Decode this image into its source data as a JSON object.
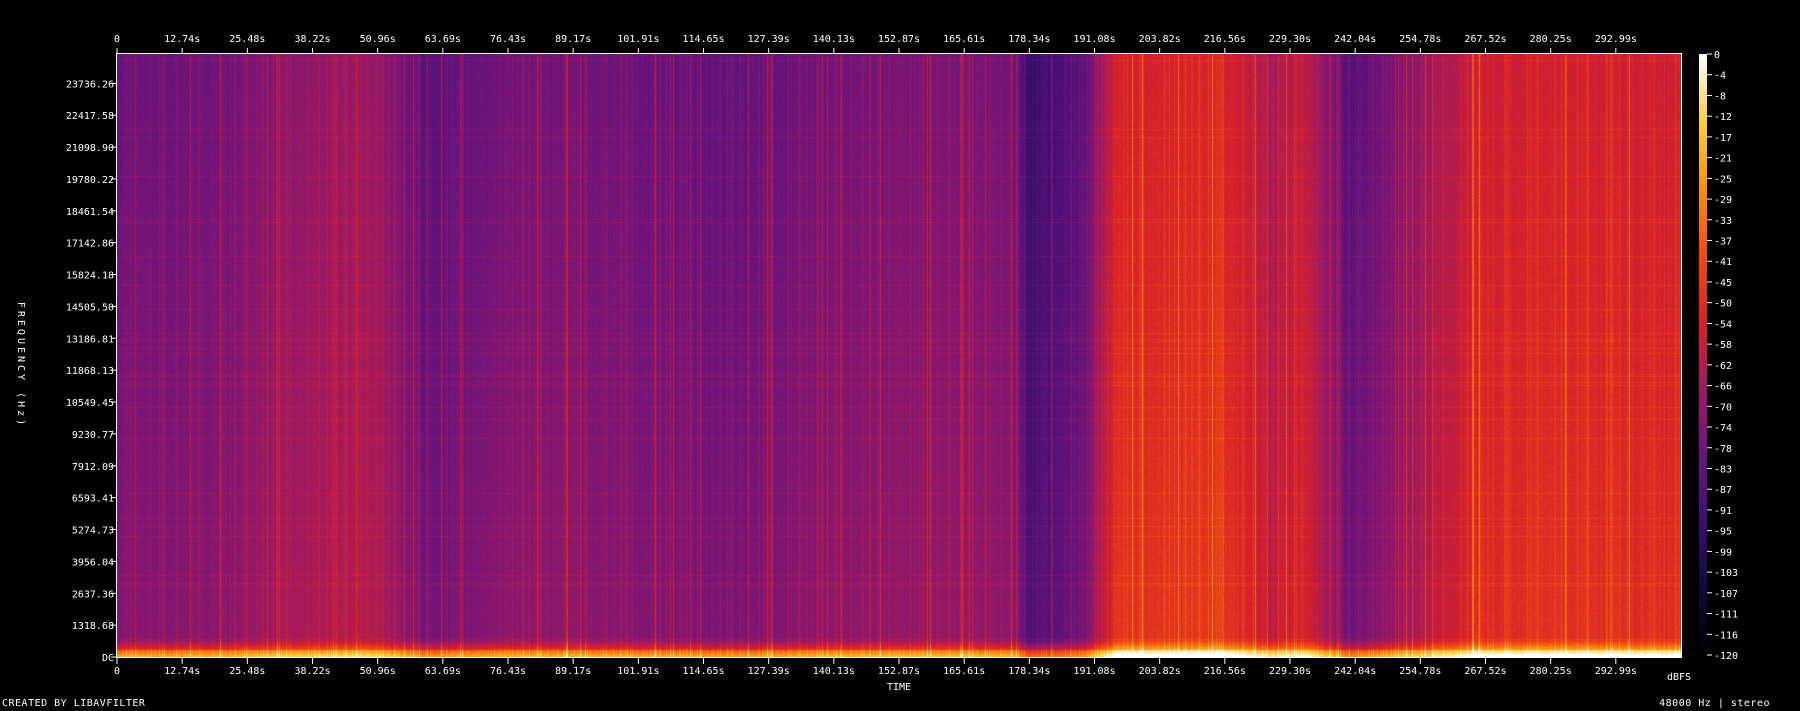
{
  "chart_data": {
    "type": "heatmap",
    "title": "",
    "xlabel": "TIME",
    "ylabel": "FREQUENCY (Hz)",
    "colorbar_label": "dBFS",
    "x_ticks": [
      "0",
      "12.74s",
      "25.48s",
      "38.22s",
      "50.96s",
      "63.69s",
      "76.43s",
      "89.17s",
      "101.91s",
      "114.65s",
      "127.39s",
      "140.13s",
      "152.87s",
      "165.61s",
      "178.34s",
      "191.08s",
      "203.82s",
      "216.56s",
      "229.30s",
      "242.04s",
      "254.78s",
      "267.52s",
      "280.25s",
      "292.99s"
    ],
    "y_ticks": [
      "DC",
      "1318.68",
      "2637.36",
      "3956.04",
      "5274.73",
      "6593.41",
      "7912.09",
      "9230.77",
      "10549.45",
      "11868.13",
      "13186.81",
      "14505.50",
      "15824.18",
      "17142.86",
      "18461.54",
      "19780.22",
      "21098.90",
      "22417.58",
      "23736.26"
    ],
    "colorbar_ticks": [
      "0",
      "-4",
      "-8",
      "-12",
      "-17",
      "-21",
      "-25",
      "-29",
      "-33",
      "-37",
      "-41",
      "-45",
      "-50",
      "-54",
      "-58",
      "-62",
      "-66",
      "-70",
      "-74",
      "-78",
      "-83",
      "-87",
      "-91",
      "-95",
      "-99",
      "-103",
      "-107",
      "-111",
      "-116",
      "-120"
    ],
    "xlim": [
      0,
      305
    ],
    "ylim": [
      0,
      24000
    ],
    "zlim": [
      -120,
      0
    ],
    "colormap": [
      "#000000",
      "#0d0a3a",
      "#3a0f70",
      "#6a147e",
      "#a01a60",
      "#d8202a",
      "#f04a14",
      "#f89012",
      "#fcd040",
      "#ffffff"
    ],
    "time_profile": [
      {
        "t": 0,
        "level": 0.4
      },
      {
        "t": 20,
        "level": 0.42
      },
      {
        "t": 38,
        "level": 0.48
      },
      {
        "t": 50,
        "level": 0.5
      },
      {
        "t": 60,
        "level": 0.36
      },
      {
        "t": 75,
        "level": 0.42
      },
      {
        "t": 90,
        "level": 0.42
      },
      {
        "t": 120,
        "level": 0.38
      },
      {
        "t": 140,
        "level": 0.42
      },
      {
        "t": 165,
        "level": 0.44
      },
      {
        "t": 175,
        "level": 0.42
      },
      {
        "t": 178,
        "level": 0.28
      },
      {
        "t": 188,
        "level": 0.36
      },
      {
        "t": 195,
        "level": 0.62
      },
      {
        "t": 215,
        "level": 0.64
      },
      {
        "t": 225,
        "level": 0.52
      },
      {
        "t": 232,
        "level": 0.58
      },
      {
        "t": 240,
        "level": 0.34
      },
      {
        "t": 250,
        "level": 0.44
      },
      {
        "t": 265,
        "level": 0.6
      },
      {
        "t": 280,
        "level": 0.62
      },
      {
        "t": 305,
        "level": 0.6
      }
    ]
  },
  "footer": {
    "credit": "CREATED BY LIBAVFILTER",
    "sample_info": "48000 Hz | stereo"
  }
}
